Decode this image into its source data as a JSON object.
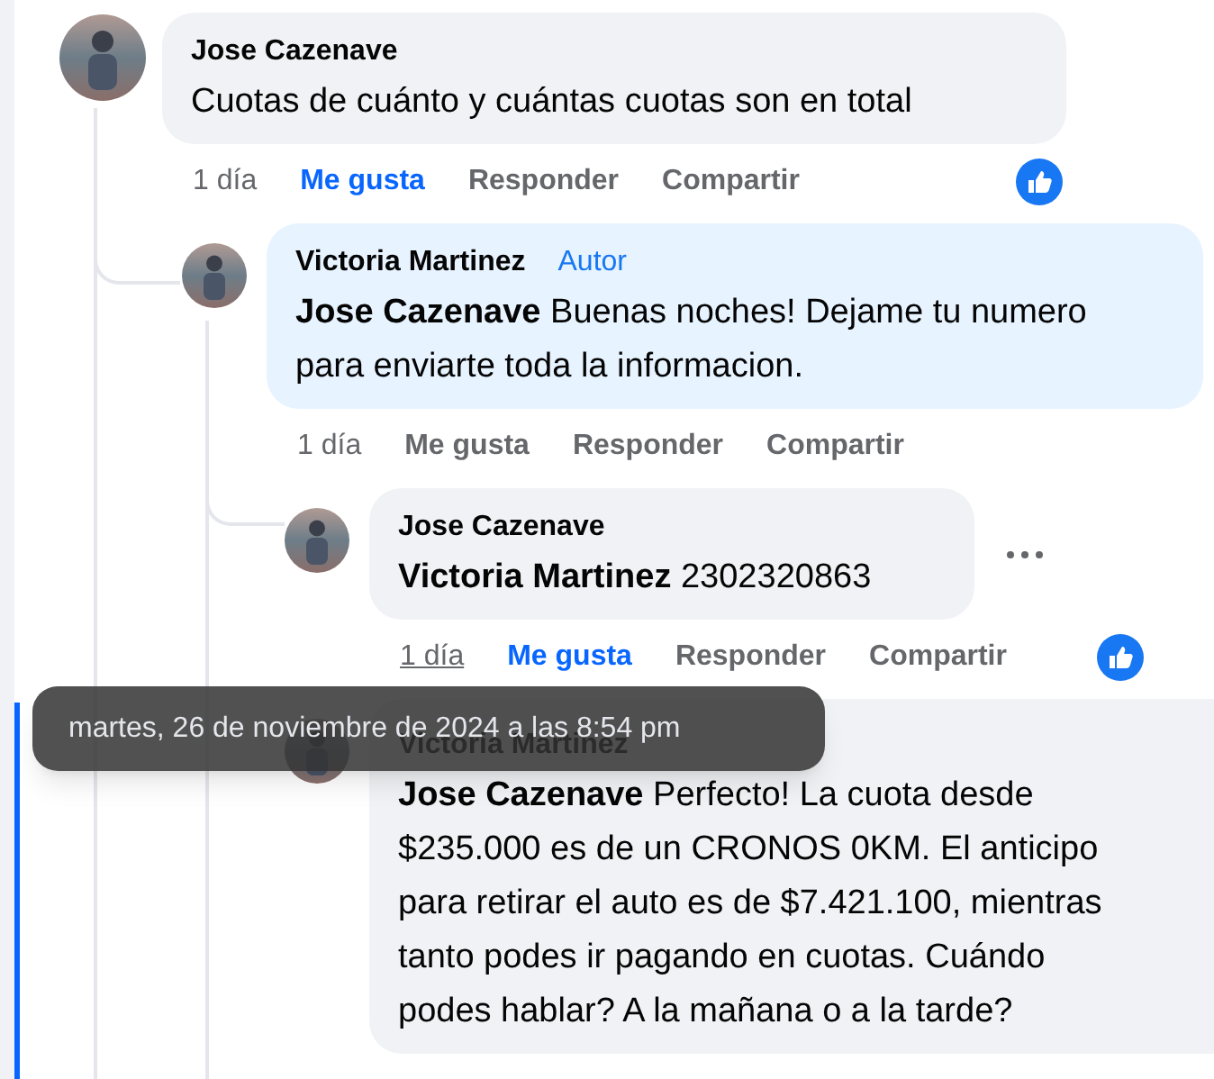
{
  "comments": [
    {
      "author": "Jose Cazenave",
      "text": "Cuotas de cuánto y cuántas cuotas son en total",
      "actions": {
        "time": "1 día",
        "time_hovered": false,
        "like": "Me gusta",
        "liked": true,
        "reply": "Responder",
        "share": "Compartir",
        "like_badge": true
      },
      "more_menu": false,
      "children": [
        {
          "author": "Victoria Martinez",
          "author_badge": "Autor",
          "text": "**Jose Cazenave** Buenas noches! Dejame tu numero para enviarte toda la informacion.",
          "actions": {
            "time": "1 día",
            "time_hovered": false,
            "like": "Me gusta",
            "liked": false,
            "reply": "Responder",
            "share": "Compartir",
            "like_badge": false
          },
          "more_menu": false,
          "children": [
            {
              "author": "Jose Cazenave",
              "text": "**Victoria Martinez** 2302320863",
              "actions": {
                "time": "1 día",
                "time_hovered": true,
                "like": "Me gusta",
                "liked": true,
                "reply": "Responder",
                "share": "Compartir",
                "like_badge": true
              },
              "more_menu": true
            },
            {
              "author": "Victoria Martinez",
              "text": "**Jose Cazenave** Perfecto! La cuota desde $235.000 es de un CRONOS 0KM. El anticipo para retirar el auto es de $7.421.100, mientras tanto podes ir pagando en cuotas. Cuándo podes hablar? A la mañana o a la tarde?",
              "highlighted": true,
              "more_menu": false
            }
          ]
        }
      ]
    }
  ],
  "tooltip": {
    "text": "martes, 26 de noviembre de 2024 a las 8:54 pm"
  }
}
